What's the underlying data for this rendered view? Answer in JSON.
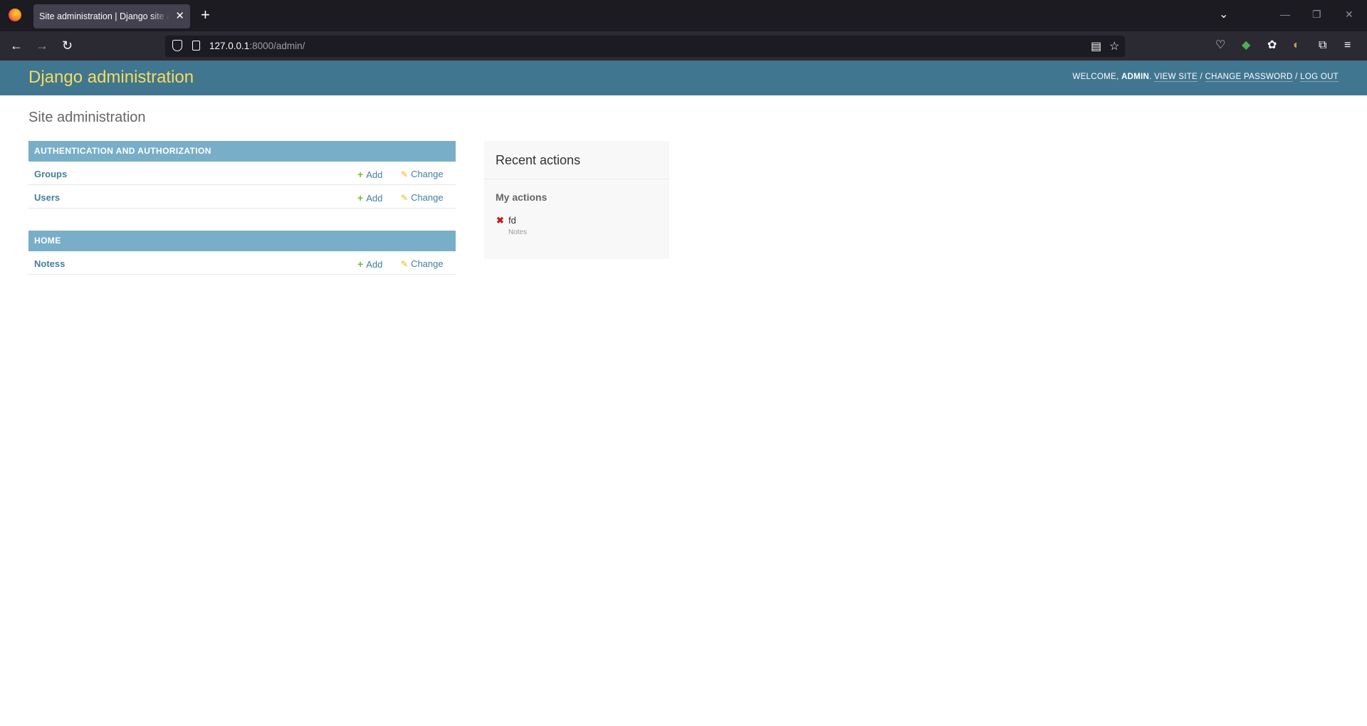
{
  "browser": {
    "tab_title": "Site administration | Django site admin",
    "url_host": "127.0.0.1",
    "url_rest": ":8000/admin/"
  },
  "header": {
    "branding": "Django administration",
    "welcome": "Welcome,",
    "username": "admin",
    "view_site": "View site",
    "change_password": "Change password",
    "log_out": "Log out",
    "sep": "/"
  },
  "page": {
    "title": "Site administration"
  },
  "modules": [
    {
      "caption": "Authentication and Authorization",
      "rows": [
        {
          "name": "Groups",
          "add": "Add",
          "change": "Change"
        },
        {
          "name": "Users",
          "add": "Add",
          "change": "Change"
        }
      ]
    },
    {
      "caption": "Home",
      "rows": [
        {
          "name": "Notess",
          "add": "Add",
          "change": "Change"
        }
      ]
    }
  ],
  "recent": {
    "title": "Recent actions",
    "subtitle": "My actions",
    "items": [
      {
        "name": "fd",
        "type": "Notes"
      }
    ]
  }
}
